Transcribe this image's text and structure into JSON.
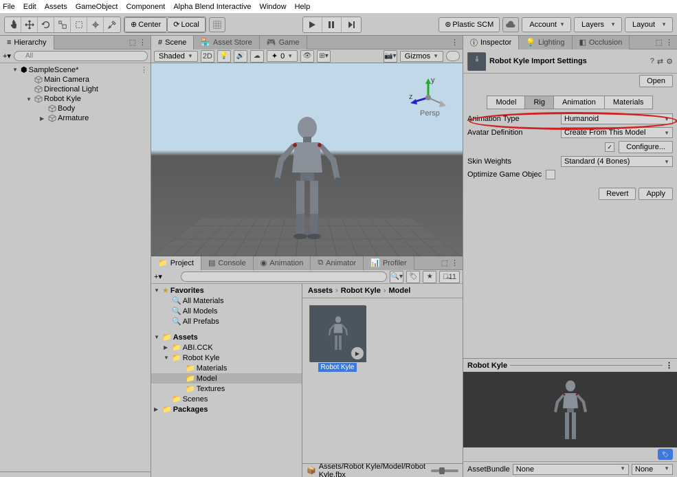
{
  "menubar": [
    "File",
    "Edit",
    "Assets",
    "GameObject",
    "Component",
    "Alpha Blend Interactive",
    "Window",
    "Help"
  ],
  "toolbar": {
    "pivot": "Center",
    "space": "Local",
    "vcs": "Plastic SCM",
    "account": "Account",
    "layers": "Layers",
    "layout": "Layout"
  },
  "hierarchy": {
    "tab": "Hierarchy",
    "search_placeholder": "All",
    "tree": [
      {
        "label": "SampleScene*",
        "depth": 1,
        "fold": "▼",
        "icon": "scene"
      },
      {
        "label": "Main Camera",
        "depth": 2,
        "icon": "cube"
      },
      {
        "label": "Directional Light",
        "depth": 2,
        "icon": "cube"
      },
      {
        "label": "Robot Kyle",
        "depth": 2,
        "fold": "▼",
        "icon": "cube"
      },
      {
        "label": "Body",
        "depth": 3,
        "icon": "cube"
      },
      {
        "label": "Armature",
        "depth": 3,
        "fold": "▶",
        "icon": "cube"
      }
    ]
  },
  "scene": {
    "tabs": [
      "Scene",
      "Asset Store",
      "Game"
    ],
    "shading": "Shaded",
    "mode2d": "2D",
    "audio_level": "0",
    "gizmos": "Gizmos"
  },
  "bottom_tabs": [
    "Project",
    "Console",
    "Animation",
    "Animator",
    "Profiler"
  ],
  "project": {
    "hidden_count": "11",
    "favorites": {
      "label": "Favorites",
      "items": [
        "All Materials",
        "All Models",
        "All Prefabs"
      ]
    },
    "assets": {
      "label": "Assets",
      "items": [
        {
          "label": "ABI.CCK",
          "fold": "▶",
          "depth": 1
        },
        {
          "label": "Robot Kyle",
          "fold": "▼",
          "depth": 1
        },
        {
          "label": "Materials",
          "depth": 2
        },
        {
          "label": "Model",
          "depth": 2,
          "selected": true
        },
        {
          "label": "Textures",
          "depth": 2
        },
        {
          "label": "Scenes",
          "depth": 1
        }
      ]
    },
    "packages_label": "Packages",
    "breadcrumb": [
      "Assets",
      "Robot Kyle",
      "Model"
    ],
    "grid_item": "Robot Kyle",
    "status_path": "Assets/Robot Kyle/Model/Robot Kyle.fbx"
  },
  "inspector": {
    "tabs": [
      "Inspector",
      "Lighting",
      "Occlusion"
    ],
    "title": "Robot Kyle Import Settings",
    "open_btn": "Open",
    "import_tabs": [
      "Model",
      "Rig",
      "Animation",
      "Materials"
    ],
    "active_import_tab": "Rig",
    "fields": {
      "anim_type_label": "Animation Type",
      "anim_type_value": "Humanoid",
      "avatar_def_label": "Avatar Definition",
      "avatar_def_value": "Create From This Model",
      "configure_btn": "Configure...",
      "skin_weights_label": "Skin Weights",
      "skin_weights_value": "Standard (4 Bones)",
      "optimize_label": "Optimize Game Objec"
    },
    "revert_btn": "Revert",
    "apply_btn": "Apply",
    "preview_title": "Robot Kyle",
    "assetbundle_label": "AssetBundle",
    "assetbundle_value": "None",
    "assetbundle_variant": "None"
  }
}
